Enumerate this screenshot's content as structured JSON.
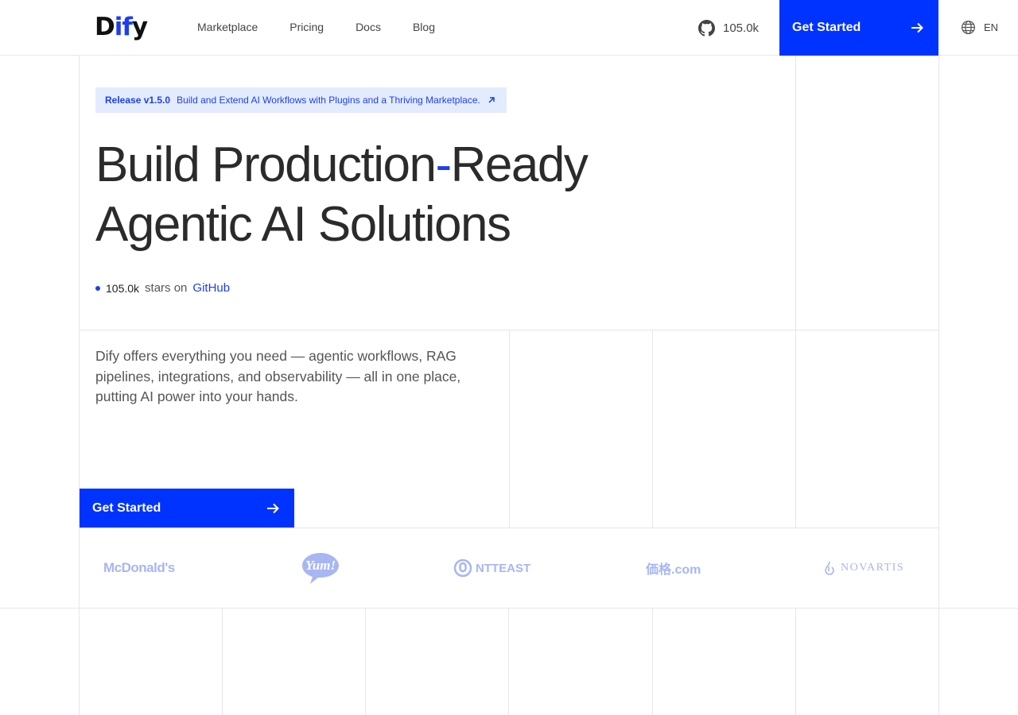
{
  "header": {
    "logo": {
      "part1": "D",
      "part2": "if",
      "part3": "y"
    },
    "nav": [
      "Marketplace",
      "Pricing",
      "Docs",
      "Blog"
    ],
    "github_stars": "105.0k",
    "cta_label": "Get Started",
    "language": "EN"
  },
  "release": {
    "version": "Release v1.5.0",
    "text": "Build and Extend AI Workflows with Plugins and a Thriving Marketplace."
  },
  "hero": {
    "line1_a": "Build Production",
    "line1_dash": "-",
    "line1_b": "Ready",
    "line2": "Agentic AI Solutions"
  },
  "stars": {
    "count": "105.0k",
    "text": "stars on",
    "link": "GitHub"
  },
  "description": "Dify offers everything you need — agentic workflows, RAG pipelines, integrations, and observability — all in one place, putting AI power into your hands.",
  "cta_label": "Get Started",
  "logos": {
    "mcdonalds": "McDonald's",
    "yum": "Yum!",
    "ntt": "NTTEAST",
    "kakaku": "価格.com",
    "novartis": "NOVARTIS"
  },
  "colors": {
    "accent": "#0033ff",
    "link": "#1d3ff0",
    "badge_bg": "#e3ebff",
    "logo_tint": "#a8b6f2"
  }
}
